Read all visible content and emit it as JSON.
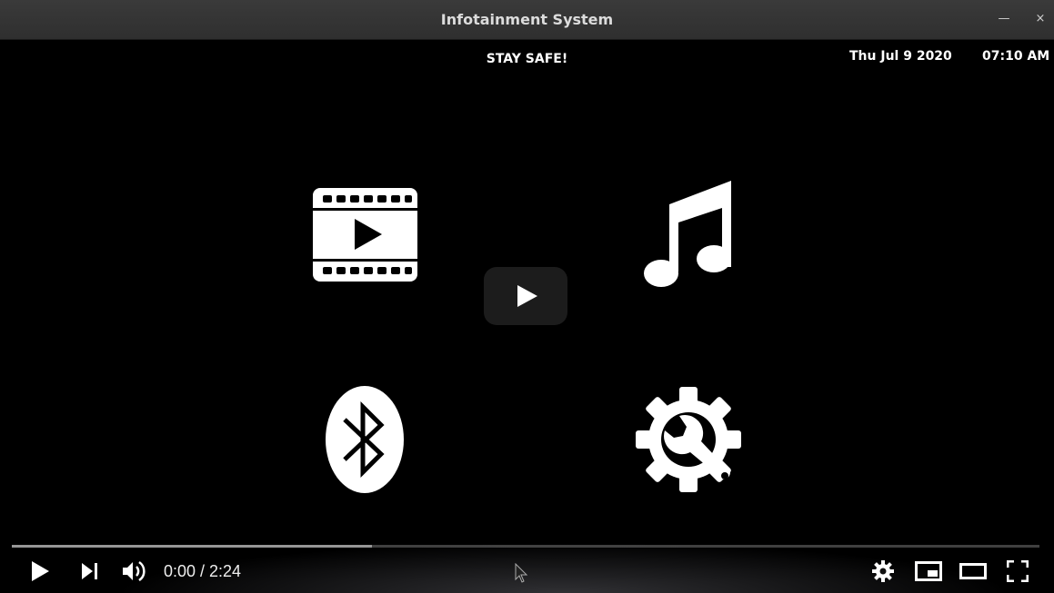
{
  "window": {
    "title": "Infotainment System",
    "minimize_icon": "minimize-icon",
    "close_icon": "close-icon"
  },
  "header": {
    "message": "STAY SAFE!",
    "date": "Thu Jul 9 2020",
    "time": "07:10 AM"
  },
  "apps": [
    {
      "name": "video",
      "icon": "film-play-icon"
    },
    {
      "name": "music",
      "icon": "music-note-icon"
    },
    {
      "name": "bluetooth",
      "icon": "bluetooth-icon"
    },
    {
      "name": "settings",
      "icon": "gear-wrench-icon"
    }
  ],
  "player": {
    "current_time": "0:00",
    "separator": " / ",
    "duration": "2:24",
    "time_display": "0:00 / 2:24",
    "buffered_fraction": 0.35,
    "played_fraction": 0.0,
    "controls": [
      "play-icon",
      "next-icon",
      "volume-icon",
      "settings-icon",
      "miniplayer-icon",
      "theater-icon",
      "fullscreen-icon"
    ]
  },
  "colors": {
    "background": "#000000",
    "titlebar": "#333333",
    "text": "#ffffff",
    "big_play_bg": "#212121"
  }
}
